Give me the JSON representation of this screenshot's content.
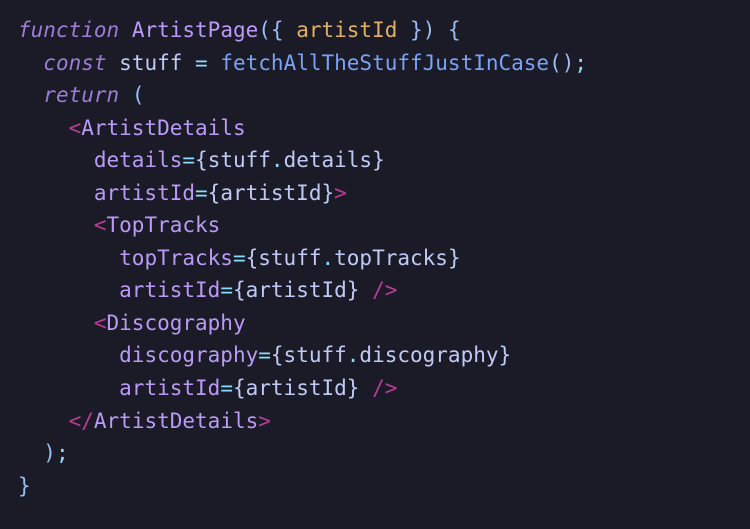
{
  "code": {
    "t_function": "function",
    "t_fnname": "ArtistPage",
    "t_artistId": "artistId",
    "t_const": "const",
    "t_stuff": "stuff",
    "t_fetchcall": "fetchAllTheStuffJustInCase",
    "t_return": "return",
    "t_ArtistDetails": "ArtistDetails",
    "t_details": "details",
    "t_TopTracks": "TopTracks",
    "t_topTracks": "topTracks",
    "t_Discography": "Discography",
    "t_discography": "discography"
  }
}
